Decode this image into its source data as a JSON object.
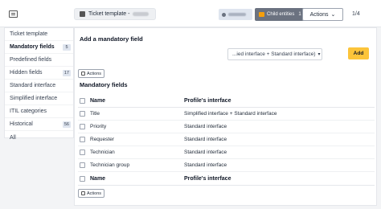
{
  "header": {
    "template_label": "Ticket template -",
    "child_label": "Child entities",
    "child_count": "1",
    "actions_label": "Actions",
    "pager": "1/4"
  },
  "sidebar": {
    "items": [
      {
        "label": "Ticket template",
        "count": ""
      },
      {
        "label": "Mandatory fields",
        "count": "5"
      },
      {
        "label": "Predefined fields",
        "count": ""
      },
      {
        "label": "Hidden fields",
        "count": "17"
      },
      {
        "label": "Standard interface",
        "count": ""
      },
      {
        "label": "Simplified interface",
        "count": ""
      },
      {
        "label": "ITIL categories",
        "count": ""
      },
      {
        "label": "Historical",
        "count": "56"
      },
      {
        "label": "All",
        "count": ""
      }
    ]
  },
  "main": {
    "add_title": "Add a mandatory field",
    "select_value": "...ied interface + Standard interface)",
    "add_button": "Add",
    "actions_label": "Actions",
    "list_title": "Mandatory fields",
    "columns": [
      "Name",
      "Profile's interface"
    ],
    "rows": [
      [
        "Title",
        "Simplified interface + Standard interface"
      ],
      [
        "Priority",
        "Standard interface"
      ],
      [
        "Requester",
        "Standard interface"
      ],
      [
        "Technician",
        "Standard interface"
      ],
      [
        "Technician group",
        "Standard interface"
      ]
    ]
  }
}
